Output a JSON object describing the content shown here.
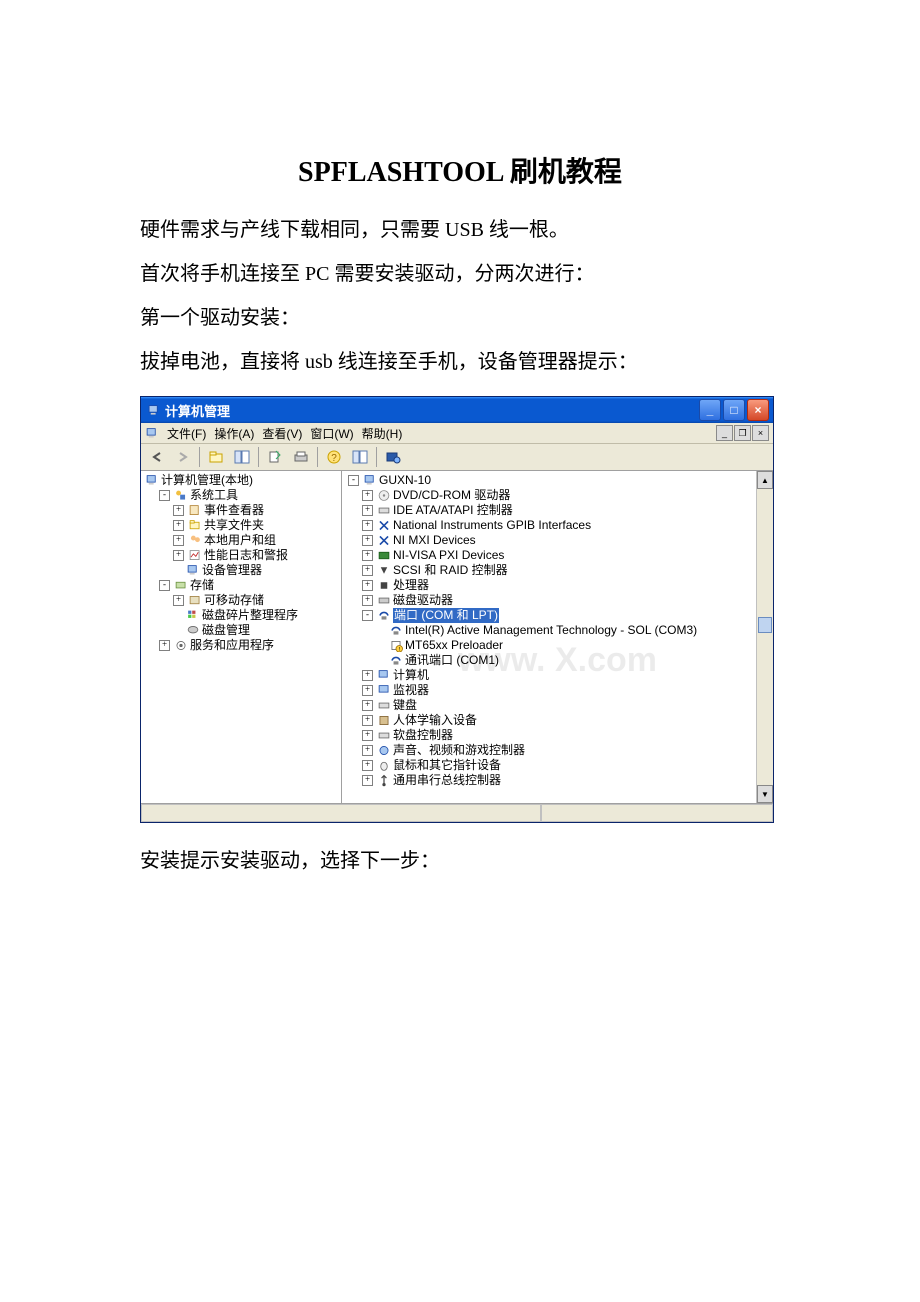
{
  "doc": {
    "title": "SPFLASHTOOL 刷机教程",
    "p1": "硬件需求与产线下载相同，只需要 USB 线一根。",
    "p2": "首次将手机连接至 PC 需要安装驱动，分两次进行：",
    "p3": "第一个驱动安装：",
    "p4": "拔掉电池，直接将 usb 线连接至手机，设备管理器提示：",
    "p5": "安装提示安装驱动，选择下一步："
  },
  "window": {
    "title": "计算机管理",
    "menu": {
      "file": "文件(F)",
      "action": "操作(A)",
      "view": "查看(V)",
      "window": "窗口(W)",
      "help": "帮助(H)"
    },
    "leftTree": {
      "root": "计算机管理(本地)",
      "systools": "系统工具",
      "eventviewer": "事件查看器",
      "shared": "共享文件夹",
      "users": "本地用户和组",
      "perf": "性能日志和警报",
      "devmgr": "设备管理器",
      "storage": "存储",
      "removable": "可移动存储",
      "defrag": "磁盘碎片整理程序",
      "diskmgmt": "磁盘管理",
      "services": "服务和应用程序"
    },
    "rightTree": {
      "computer": "GUXN-10",
      "dvd": "DVD/CD-ROM 驱动器",
      "ide": "IDE ATA/ATAPI 控制器",
      "gpib": "National Instruments GPIB Interfaces",
      "nimxi": "NI MXI Devices",
      "nivisa": "NI-VISA PXI Devices",
      "scsi": "SCSI 和 RAID 控制器",
      "cpu": "处理器",
      "disk": "磁盘驱动器",
      "ports": "端口 (COM 和 LPT)",
      "intel": "Intel(R) Active Management Technology - SOL (COM3)",
      "preloader": "MT65xx Preloader",
      "com1": "通讯端口 (COM1)",
      "computers": "计算机",
      "monitor": "监视器",
      "keyboard": "键盘",
      "hid": "人体学输入设备",
      "fdc": "软盘控制器",
      "sound": "声音、视频和游戏控制器",
      "mouse": "鼠标和其它指针设备",
      "usb": "通用串行总线控制器"
    },
    "watermark": "www.  X.com"
  }
}
